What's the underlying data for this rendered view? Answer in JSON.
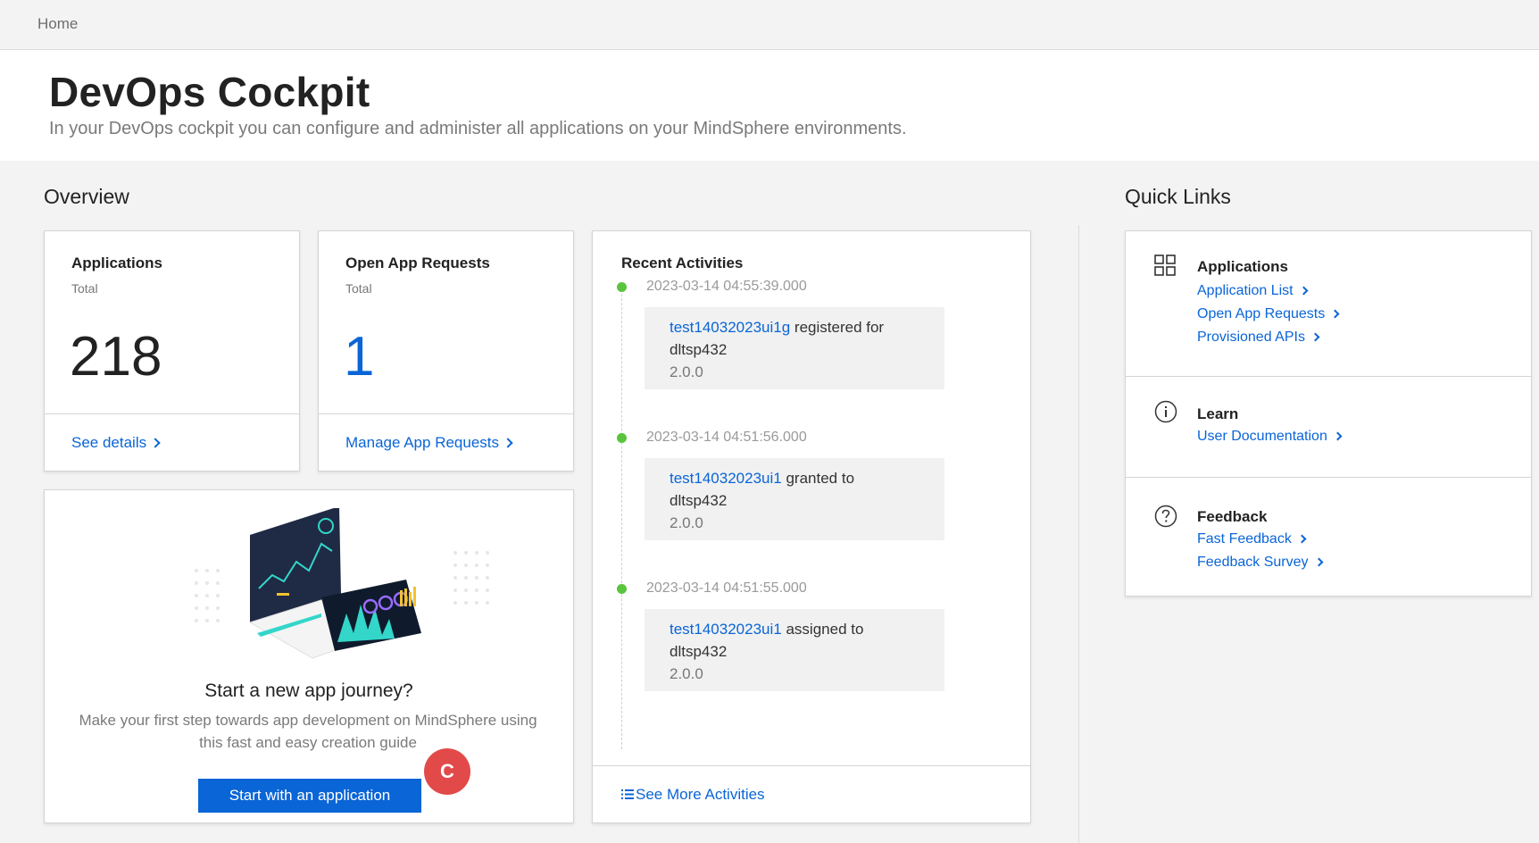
{
  "breadcrumb": {
    "home": "Home"
  },
  "header": {
    "title": "DevOps Cockpit",
    "subtitle": "In your DevOps cockpit you can configure and administer all applications on your MindSphere environments."
  },
  "overview": {
    "title": "Overview",
    "applications": {
      "title": "Applications",
      "sub": "Total",
      "count": "218",
      "link": "See details"
    },
    "open_requests": {
      "title": "Open App Requests",
      "sub": "Total",
      "count": "1",
      "link": "Manage App Requests"
    },
    "journey": {
      "title": "Start a new app journey?",
      "description": "Make your first step towards app development on MindSphere using this fast and easy creation guide",
      "button": "Start with an application",
      "badge": "C"
    }
  },
  "activities": {
    "title": "Recent Activities",
    "items": [
      {
        "time": "2023-03-14 04:55:39.000",
        "entity": "test14032023ui1g",
        "action": "registered for",
        "target": "dltsp432",
        "version": "2.0.0"
      },
      {
        "time": "2023-03-14 04:51:56.000",
        "entity": "test14032023ui1",
        "action": "granted to",
        "target": "dltsp432",
        "version": "2.0.0"
      },
      {
        "time": "2023-03-14 04:51:55.000",
        "entity": "test14032023ui1",
        "action": "assigned to",
        "target": "dltsp432",
        "version": "2.0.0"
      }
    ],
    "more_link": "See More Activities"
  },
  "quick_links": {
    "title": "Quick Links",
    "sections": [
      {
        "title": "Applications",
        "icon": "grid-icon",
        "links": [
          "Application List",
          "Open App Requests",
          "Provisioned APIs"
        ]
      },
      {
        "title": "Learn",
        "icon": "info-icon",
        "links": [
          "User Documentation"
        ]
      },
      {
        "title": "Feedback",
        "icon": "help-icon",
        "links": [
          "Fast Feedback",
          "Feedback Survey"
        ]
      }
    ]
  },
  "colors": {
    "accent": "#0a65d6",
    "dot": "#59c43d",
    "badge": "#e24a4a"
  }
}
